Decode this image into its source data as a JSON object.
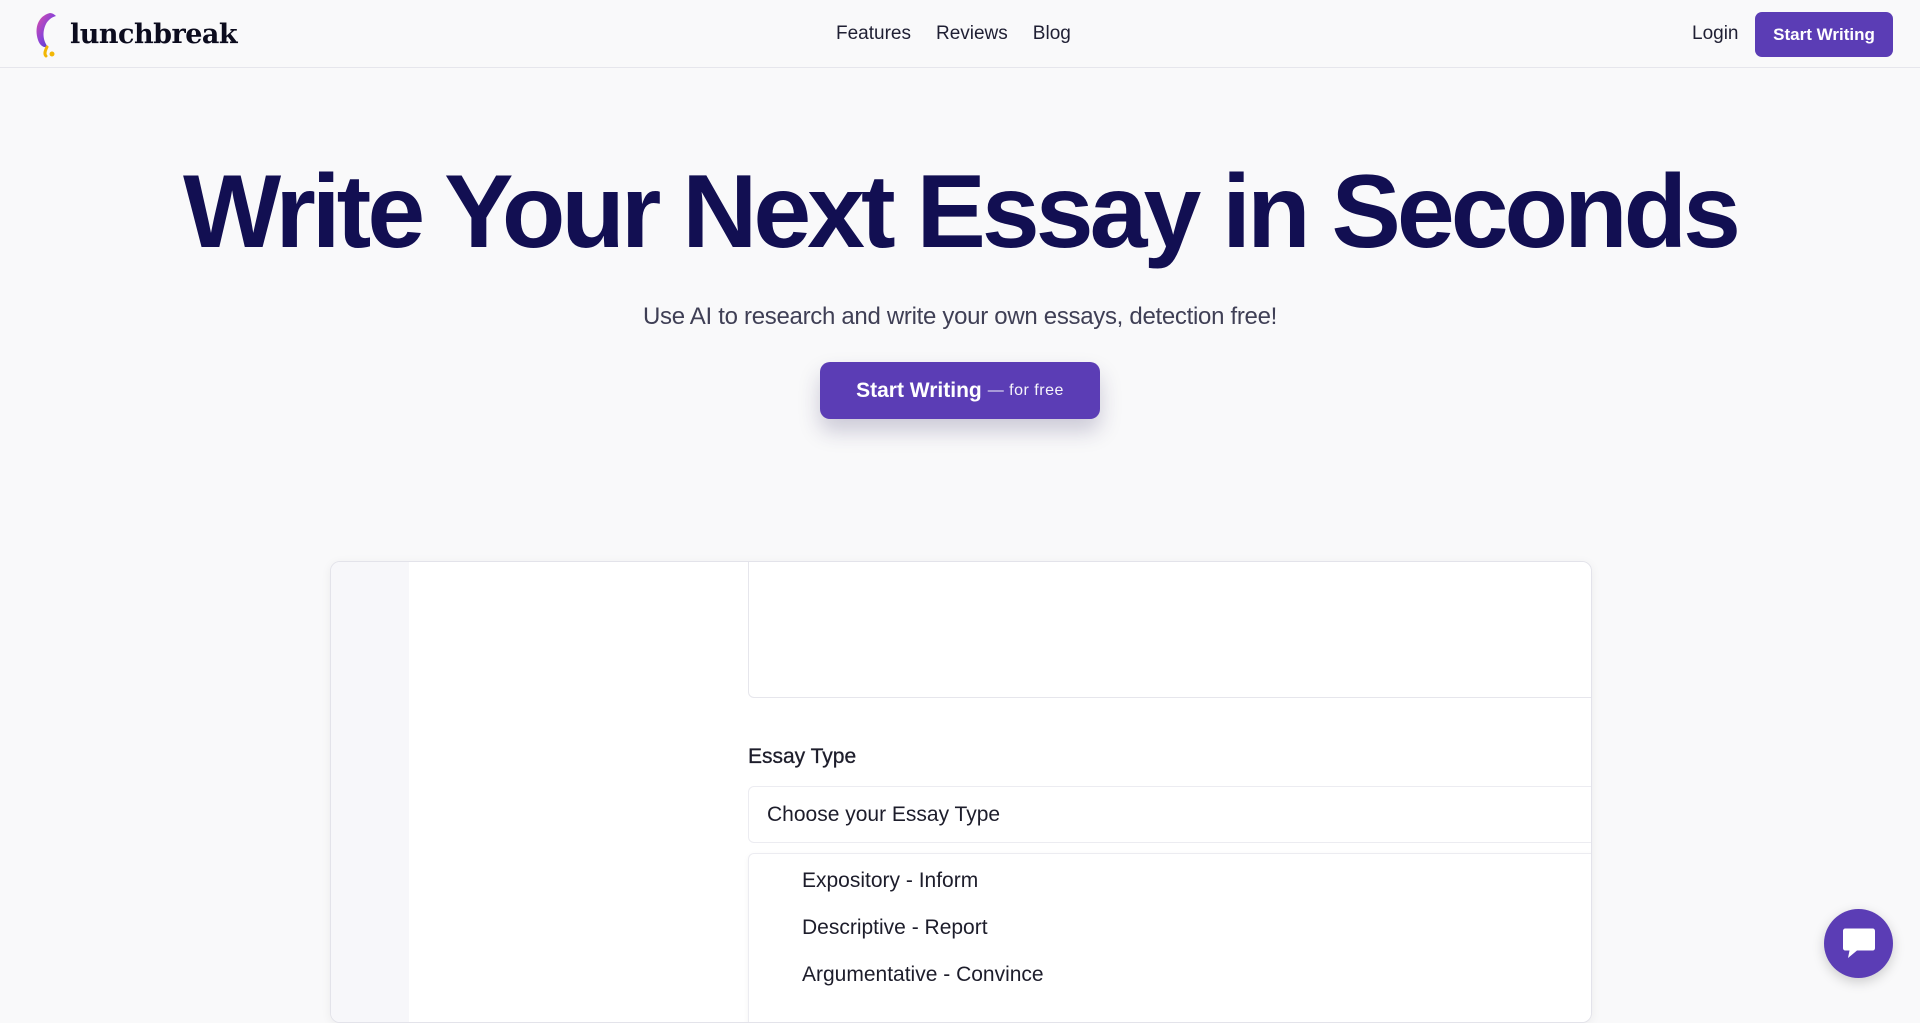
{
  "brand": {
    "name": "lunchbreak",
    "accent_color": "#5b3db5",
    "title_color": "#120f52"
  },
  "header": {
    "nav": [
      "Features",
      "Reviews",
      "Blog"
    ],
    "login_label": "Login",
    "cta_label": "Start Writing"
  },
  "hero": {
    "title": "Write Your Next Essay in Seconds",
    "subtitle": "Use AI to research and write your own essays, detection free!",
    "cta_main": "Start Writing",
    "cta_sub": "— for free"
  },
  "preview": {
    "essay_type_label": "Essay Type",
    "essay_type_placeholder": "Choose your Essay Type",
    "essay_type_options": [
      "Expository - Inform",
      "Descriptive - Report",
      "Argumentative - Convince"
    ]
  },
  "chat": {
    "icon": "chat-bubble-icon"
  }
}
